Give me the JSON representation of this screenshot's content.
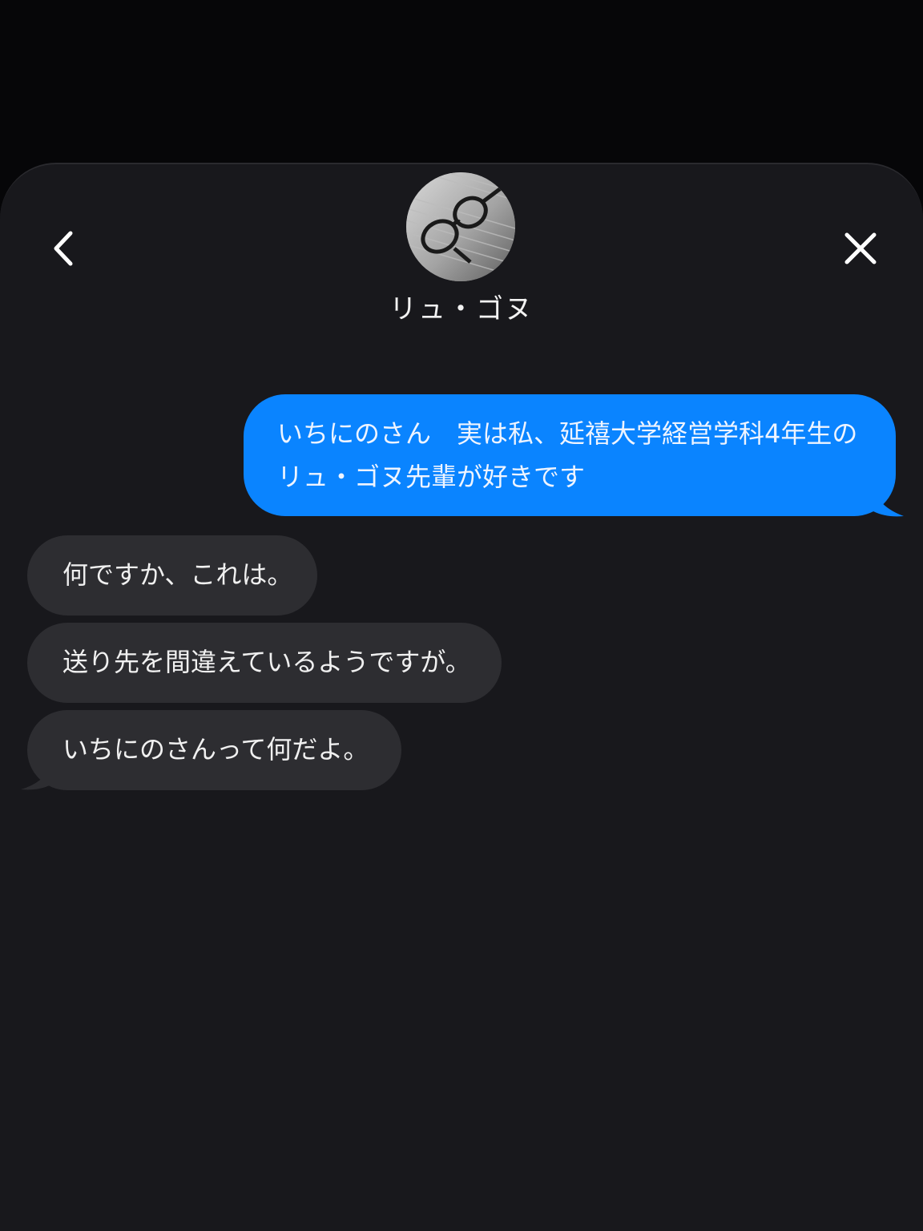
{
  "header": {
    "back_icon": "chevron-left-icon",
    "close_icon": "close-icon",
    "contact_name": "リュ・ゴヌ",
    "avatar_icon": "glasses-avatar-photo"
  },
  "messages": [
    {
      "direction": "outgoing",
      "lines": [
        "いちにのさん　実は私、延禧大学経営学科4年生の",
        "リュ・ゴヌ先輩が好きです"
      ]
    },
    {
      "direction": "incoming",
      "text": "何ですか、これは。"
    },
    {
      "direction": "incoming",
      "text": "送り先を間違えているようですが。"
    },
    {
      "direction": "incoming",
      "text": "いちにのさんって何だよ。"
    }
  ],
  "colors": {
    "outgoing_bubble": "#0a84ff",
    "incoming_bubble": "#2d2d31",
    "background": "#18181c"
  }
}
